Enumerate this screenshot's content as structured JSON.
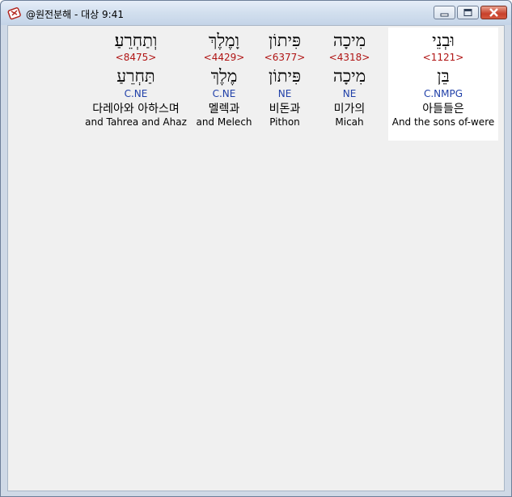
{
  "window": {
    "title": "@원전분해 - 대상 9:41",
    "icon": "app-bible-icon"
  },
  "words": [
    {
      "id": "w1",
      "hebrew": "וּבְנֵי",
      "strong": "<1121>",
      "lemma": "בֵּן",
      "morph": "C.NMPG",
      "korean": "아들들은",
      "english": "And the sons of-were"
    },
    {
      "id": "w2",
      "hebrew": "מִיכָה",
      "strong": "<4318>",
      "lemma": "מִיכָה",
      "morph": "NE",
      "korean": "미가의",
      "english": "Micah"
    },
    {
      "id": "w3",
      "hebrew": "פִּיתוֹן",
      "strong": "<6377>",
      "lemma": "פִּיתוֹן",
      "morph": "NE",
      "korean": "비돈과",
      "english": "Pithon"
    },
    {
      "id": "w4",
      "hebrew": "וָמֶלֶךְ",
      "strong": "<4429>",
      "lemma": "מֶלֶךְ",
      "morph": "C.NE",
      "korean": "멜렉과",
      "english": "and Melech"
    },
    {
      "id": "w5",
      "hebrew": "וְתַחְרֵעַ׃",
      "strong": "<8475>",
      "lemma": "תַּחְרֵעַ",
      "morph": "C.NE",
      "korean": "다레아와 아하스며",
      "english": "and Tahrea and Ahaz"
    }
  ],
  "colors": {
    "strong": "#b01414",
    "morph": "#1f3fa8",
    "selected_bg": "#ffffff",
    "client_bg": "#f0f0f0"
  }
}
